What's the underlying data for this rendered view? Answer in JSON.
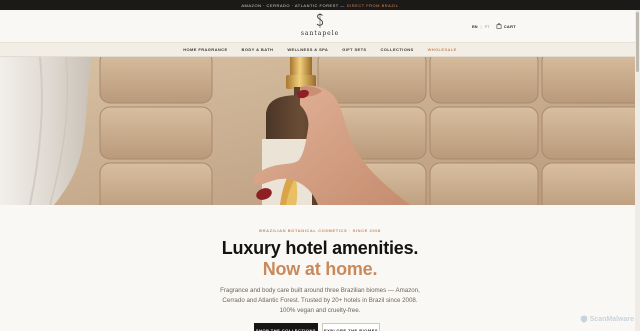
{
  "announcement": {
    "text": "AMAZON · CERRADO · ATLANTIC FOREST —",
    "highlight": "DIRECT FROM BRAZIL"
  },
  "brand": {
    "name": "santapele",
    "icon": "s-monogram-icon"
  },
  "header": {
    "lang_active": "EN",
    "lang_other": "PT",
    "cart_label": "CART",
    "cart_icon": "bag-icon"
  },
  "nav": {
    "items": [
      {
        "label": "HOME FRAGRANCE"
      },
      {
        "label": "BODY & BATH"
      },
      {
        "label": "WELLNESS & SPA"
      },
      {
        "label": "GIFT SETS"
      },
      {
        "label": "COLLECTIONS"
      },
      {
        "label": "WHOLESALE"
      }
    ]
  },
  "hero": {
    "eyebrow": "BRAZILIAN BOTANICAL COSMETICS · SINCE 2008",
    "title_line1": "Luxury hotel amenities.",
    "title_line2": "Now at home.",
    "description": "Fragrance and body care built around three Brazilian biomes — Amazon, Cerrado and Atlantic Forest. Trusted by 20+ hotels in Brazil since 2008. 100% vegan and cruelty-free.",
    "cta_primary": "SHOP THE COLLECTIONS",
    "cta_secondary": "EXPLORE THE BIOMES"
  },
  "watermark": {
    "text": "ScanMalware",
    "icon": "shield-icon"
  },
  "colors": {
    "accent": "#c98a5b",
    "dark": "#1b1a18",
    "background": "#faf8f4"
  }
}
